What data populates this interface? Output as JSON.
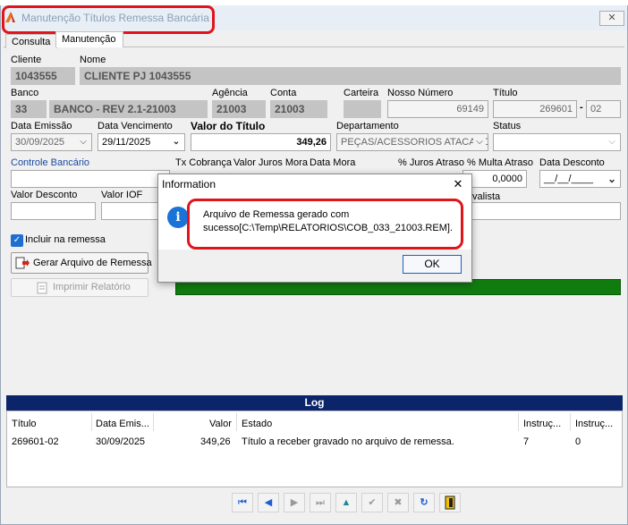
{
  "window": {
    "title": "Manutenção Títulos Remessa Bancária",
    "close": "✕"
  },
  "tabs": [
    {
      "label": "Consulta"
    },
    {
      "label": "Manutenção"
    }
  ],
  "form": {
    "cliente_label": "Cliente",
    "cliente_value": "1043555",
    "nome_label": "Nome",
    "nome_value": "CLIENTE PJ 1043555",
    "banco_label": "Banco",
    "banco_code": "33",
    "banco_name": "BANCO - REV 2.1-21003",
    "agencia_label": "Agência",
    "agencia_value": "21003",
    "conta_label": "Conta",
    "conta_value": "21003",
    "carteira_label": "Carteira",
    "carteira_value": "",
    "nosso_numero_label": "Nosso Número",
    "nosso_numero_value": "69149",
    "titulo_label": "Título",
    "titulo_value": "269601",
    "titulo_dash": "-",
    "titulo_parcela": "02",
    "data_emissao_label": "Data Emissão",
    "data_emissao_value": "30/09/2025",
    "data_vencimento_label": "Data Vencimento",
    "data_vencimento_value": "29/11/2025",
    "valor_titulo_label": "Valor do Título",
    "valor_titulo_value": "349,26",
    "departamento_label": "Departamento",
    "departamento_value": "PEÇAS/ACESSORIOS ATACADO",
    "status_label": "Status",
    "status_value": "",
    "controle_bancario_label": "Controle Bancário",
    "tx_cobranca_label": "Tx Cobrança",
    "valor_juros_mora_label": "Valor Juros Mora",
    "data_mora_label": "Data Mora",
    "juros_atraso_label": "% Juros Atraso",
    "multa_atraso_label": "% Multa Atraso",
    "multa_atraso_value": "0,0000",
    "data_desconto_label": "Data Desconto",
    "data_desconto_value": "__/__/____",
    "valor_desconto_label": "Valor Desconto",
    "valor_iof_label": "Valor IOF",
    "avalista_label": "valista"
  },
  "checkbox": {
    "label": "Incluir na remessa",
    "checked": true
  },
  "buttons": {
    "gerar": "Gerar Arquivo de Remessa",
    "imprimir": "Imprimir Relatório"
  },
  "progress": {
    "percent": 100,
    "color": "#107c10"
  },
  "dialog": {
    "title": "Information",
    "close": "✕",
    "icon": "i",
    "message_line1": "Arquivo de Remessa gerado com",
    "message_line2": "sucesso[C:\\Temp\\RELATORIOS\\COB_033_21003.REM].",
    "ok": "OK"
  },
  "log": {
    "title": "Log",
    "columns": [
      "Título",
      "Data Emis...",
      "Valor",
      "Estado",
      "Instruç...",
      "Instruç..."
    ],
    "rows": [
      [
        "269601-02",
        "30/09/2025",
        "349,26",
        "Título a receber gravado no arquivo de remessa.",
        "7",
        "0"
      ]
    ]
  },
  "navigator": {
    "icons": [
      "first-icon",
      "prior-icon",
      "next-icon",
      "last-icon",
      "insert-icon",
      "post-icon",
      "cancel-icon",
      "refresh-icon",
      "exit-icon"
    ]
  },
  "colors": {
    "log_header": "#0c246a",
    "progress": "#107c10",
    "annotation": "#e0151b",
    "info_icon": "#1a73d8"
  }
}
